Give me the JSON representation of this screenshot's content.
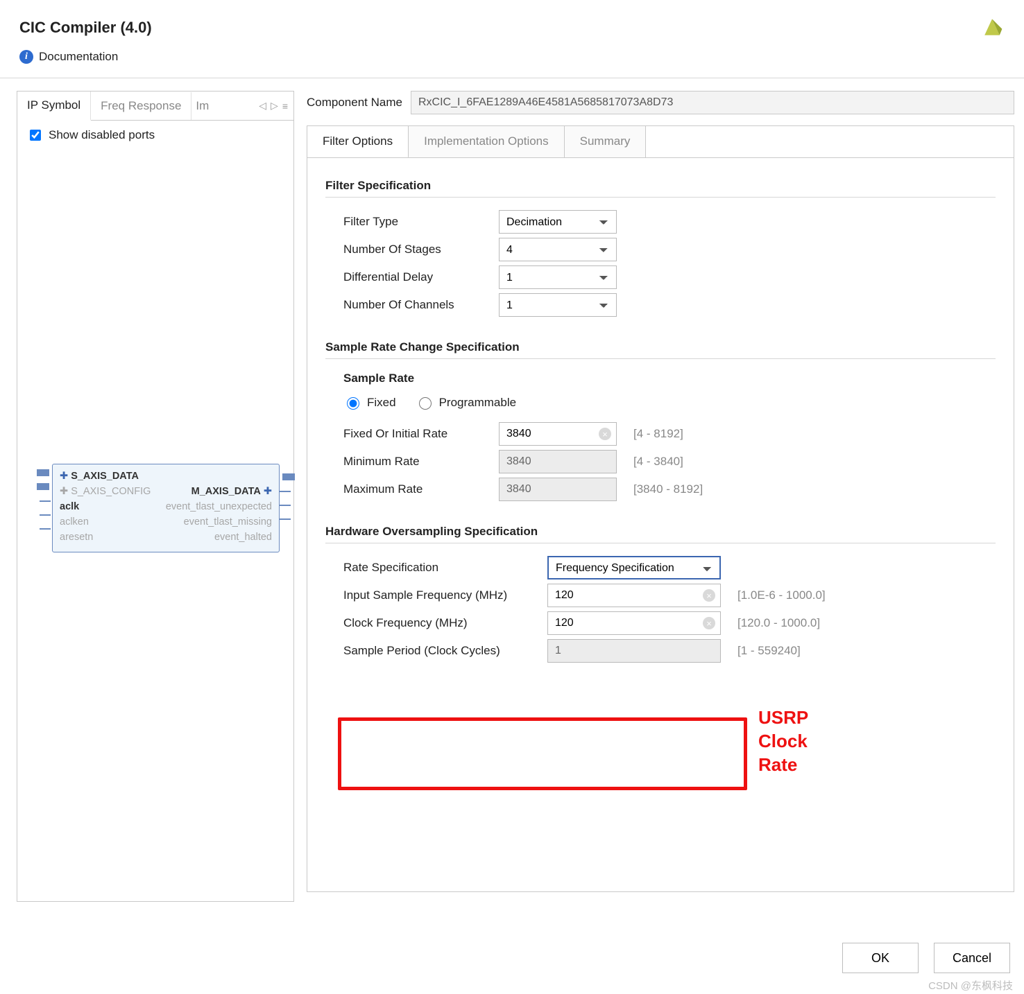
{
  "header": {
    "title": "CIC Compiler (4.0)",
    "doc_label": "Documentation"
  },
  "left": {
    "tabs": [
      "IP Symbol",
      "Freq Response",
      "Im"
    ],
    "show_disabled_label": "Show disabled ports",
    "show_disabled_checked": true,
    "ip": {
      "in": [
        {
          "name": "S_AXIS_DATA",
          "enabled": true,
          "plus": true
        },
        {
          "name": "S_AXIS_CONFIG",
          "enabled": false,
          "plus": true
        },
        {
          "name": "aclk",
          "enabled": true,
          "plus": false
        },
        {
          "name": "aclken",
          "enabled": false,
          "plus": false
        },
        {
          "name": "aresetn",
          "enabled": false,
          "plus": false
        }
      ],
      "out": [
        {
          "name": "M_AXIS_DATA",
          "enabled": true,
          "plus": true
        },
        {
          "name": "event_tlast_unexpected",
          "enabled": false,
          "plus": false
        },
        {
          "name": "event_tlast_missing",
          "enabled": false,
          "plus": false
        },
        {
          "name": "event_halted",
          "enabled": false,
          "plus": false
        }
      ]
    }
  },
  "component": {
    "label": "Component Name",
    "value": "RxCIC_I_6FAE1289A46E4581A5685817073A8D73"
  },
  "cfgtabs": [
    "Filter Options",
    "Implementation Options",
    "Summary"
  ],
  "filter_spec": {
    "heading": "Filter Specification",
    "filter_type": {
      "label": "Filter Type",
      "value": "Decimation"
    },
    "stages": {
      "label": "Number Of Stages",
      "value": "4"
    },
    "diff_delay": {
      "label": "Differential Delay",
      "value": "1"
    },
    "channels": {
      "label": "Number Of Channels",
      "value": "1"
    }
  },
  "rate_spec": {
    "heading": "Sample Rate Change Specification",
    "sub": "Sample Rate",
    "mode": {
      "fixed": "Fixed",
      "prog": "Programmable",
      "selected": "fixed"
    },
    "fixed": {
      "label": "Fixed Or Initial Rate",
      "value": "3840",
      "hint": "[4 - 8192]"
    },
    "min": {
      "label": "Minimum Rate",
      "value": "3840",
      "hint": "[4 - 3840]"
    },
    "max": {
      "label": "Maximum Rate",
      "value": "3840",
      "hint": "[3840 - 8192]"
    }
  },
  "hw_spec": {
    "heading": "Hardware Oversampling Specification",
    "rate_spec": {
      "label": "Rate Specification",
      "value": "Frequency Specification"
    },
    "in_freq": {
      "label": "Input Sample Frequency (MHz)",
      "value": "120",
      "hint": "[1.0E-6 - 1000.0]"
    },
    "clk_freq": {
      "label": "Clock Frequency (MHz)",
      "value": "120",
      "hint": "[120.0 - 1000.0]"
    },
    "period": {
      "label": "Sample Period (Clock Cycles)",
      "value": "1",
      "hint": "[1 - 559240]"
    }
  },
  "annotation": "USRP\nClock\nRate",
  "buttons": {
    "ok": "OK",
    "cancel": "Cancel"
  },
  "watermark": "CSDN @东枫科技"
}
